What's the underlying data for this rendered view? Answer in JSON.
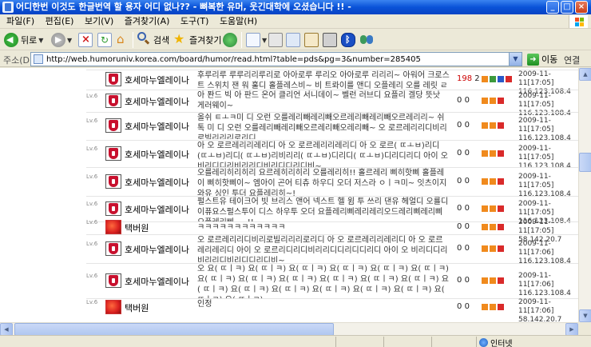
{
  "window": {
    "title": "어디한번 이것도 한글번역 할 용자 어디 없나?? - 뼈복한 유머, 웃긴대학에 오셨습니다 !! -",
    "controls": {
      "minimize": "_",
      "maximize": "□",
      "close": "×"
    }
  },
  "menu": [
    "파일(F)",
    "편집(E)",
    "보기(V)",
    "즐겨찾기(A)",
    "도구(T)",
    "도움말(H)"
  ],
  "toolbar": {
    "back_label": "뒤로",
    "search_label": "검색",
    "favorites_label": "즐겨찾기"
  },
  "address": {
    "label": "주소(D)",
    "url": "http://web.humoruniv.korea.com/board/humor/read.html?table=pds&pg=3&number=285405",
    "go_label": "이동",
    "links_label": "연결"
  },
  "comments": [
    {
      "level": "",
      "avatar": "lfc",
      "nick": "호세마누엘레이나",
      "text": "후루리루 루루리리루리로 아아로루 루리오 아아로루 리리리~ 아워어 크로스트 스위치 잰 워 훌디 홀플레스비~ 비 트롸이를 앤디 오플레리 오를 레릿   ㄹㅣㅋ비~",
      "up": "198",
      "down": "2",
      "date": "2009-11-11[17:05]",
      "ip": "116.123.108.4"
    },
    {
      "level": "Lv.6",
      "avatar": "lfc",
      "nick": "호세마누엘레이나",
      "text": "아 퐌드 빅 아 판드 온어 클리언 서니데이~ 벨런 러브디 요플리 겔당 뜻낫 게러웨이~",
      "up": "0",
      "down": "0",
      "date": "2009-11-11[17:05]",
      "ip": "116.123.108.4"
    },
    {
      "level": "Lv.6",
      "avatar": "lfc",
      "nick": "호세마누엘레이나",
      "text": "올쉬  ㅌㅗㅋ미 디 오런 오를레리빼레리빼오르레리빼레리빼오르레리리~ 쉬 톡 미 디 오런 오를레리빼레리빼오르레리빼오레리빼~ 오 로르레리리디비리로빌리리리로리디",
      "up": "0",
      "down": "0",
      "date": "2009-11-11[17:05]",
      "ip": "116.123.108.4"
    },
    {
      "level": "Lv.6",
      "avatar": "lfc",
      "nick": "호세마누엘레이나",
      "text": "아 오 로르레리리레리디 아 오 로르레리리레리디 아 오 로르(  ㄸㅗㅂ)리디(ㄸㅗㅂ)리디(  ㄸㅗㅂ)리비리리(  ㄸㅗㅂ)디리디(  ㄸㅗㅂ)디리디리디 아이 오 비리디디리비리리디비리디디리디비~",
      "up": "0",
      "down": "0",
      "date": "2009-11-11[17:05]",
      "ip": "116.123.108.4"
    },
    {
      "level": "Lv.6",
      "avatar": "lfc",
      "nick": "호세마누엘레이나",
      "text": "오를레리히리히리 요르레히리히리 오를레리히!! 홀르레리 삐히핫삐 홀플레이 삐히핫삐이~ 엠아이 곤어 티츄 하우디 오더 저스라   ㅇㅣㅋ미~ 잇츠이지 와유 싱인 투더 요플레리히~!",
      "up": "0",
      "down": "0",
      "date": "2009-11-11[17:05]",
      "ip": "116.123.108.4"
    },
    {
      "level": "Lv.6",
      "avatar": "lfc",
      "nick": "호세마누엘레이나",
      "text": "펄스트유 테이크어 빗 브리스 앤어 넥스트 헬 윔 투 쓰리 댄유 헤얼디 오룔디 이퓨요스펄스투이 디스 하우투 오더 요플레리삐레리레리오드레리삐레리삐오플레리삐~~!!",
      "up": "0",
      "down": "0",
      "date": "2009-11-11[17:05]",
      "ip": "116.123.108.4"
    },
    {
      "level": "Lv.6",
      "avatar": "flower",
      "nick": "택버원",
      "text": "ㅋㅋㅋㅋㅋㅋㅋㅋㅋㅋㅋㅋ",
      "up": "0",
      "down": "0",
      "date": "2009-11-11[17:05]",
      "ip": "58.142.20.7"
    },
    {
      "level": "Lv.6",
      "avatar": "lfc",
      "nick": "호세마누엘레이나",
      "text": "오 로르레리리디비리로빌리리리로리디 아 오 로르레리리레리디 아 오 로르레리레리디 아이 오 로르리디리디비리리디디리디디리디 아이 오 비리디디리비리리디비리디디리디비~",
      "up": "0",
      "down": "0",
      "date": "2009-11-11[17:06]",
      "ip": "116.123.108.4"
    },
    {
      "level": "Lv.6",
      "avatar": "lfc",
      "nick": "호세마누엘레이나",
      "text": "오 요(  ㄸㅣㅋ) 요(  ㄸㅣㅋ) 요(  ㄸㅣㅋ) 요(  ㄸㅣㅋ) 요(  ㄸㅣㅋ) 요(  ㄸㅣㅋ) 요(  ㄸㅣㅋ) 요(  ㄸㅣㅋ) 요(  ㄸㅣㅋ) 요(  ㄸㅣㅋ) 요(  ㄸㅣㅋ) 요(  ㄸㅣㅋ) 요(  ㄸㅣㅋ) 요(  ㄸㅣㅋ) 요(  ㄸㅣㅋ) 요(  ㄸㅣㅋ) 요(  ㄸㅣㅋ) 요(  ㄸㅣㅋ) 요(  ㄸㅣㅋ) 요(  ㄸㅣㅋ)",
      "up": "0",
      "down": "0",
      "date": "2009-11-11[17:06]",
      "ip": "116.123.108.4"
    },
    {
      "level": "Lv.6",
      "avatar": "flower",
      "nick": "택버원",
      "text": "인정",
      "up": "0",
      "down": "0",
      "date": "2009-11-11[17:06]",
      "ip": "58.142.20.7"
    }
  ],
  "status": {
    "zone": "인터넷"
  },
  "colors": {
    "title_bar": "#0a53d8",
    "red_count": "#cc0000"
  }
}
